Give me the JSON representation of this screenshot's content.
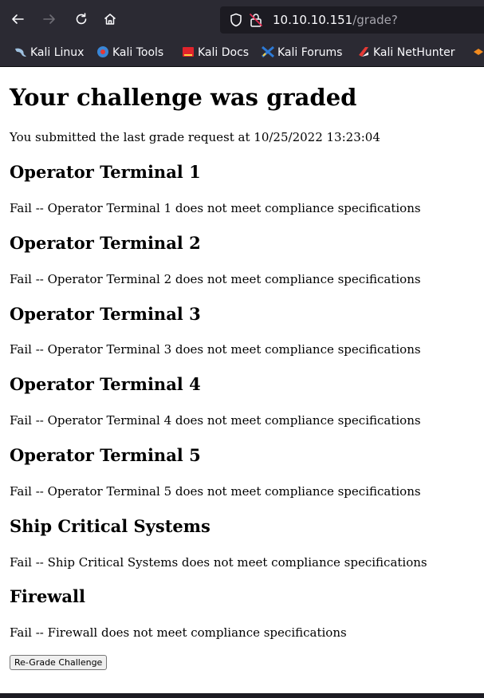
{
  "browser": {
    "url_host": "10.10.10.151",
    "url_path": "/grade?",
    "bookmarks": [
      {
        "label": "Kali Linux",
        "icon": "kali-dragon-icon",
        "color": "#9fc1e0"
      },
      {
        "label": "Kali Tools",
        "icon": "kali-tools-icon",
        "color": "#3a86d6"
      },
      {
        "label": "Kali Docs",
        "icon": "kali-docs-icon",
        "color": "#e0242c"
      },
      {
        "label": "Kali Forums",
        "icon": "kali-forums-icon",
        "color": "#2d7ad6"
      },
      {
        "label": "Kali NetHunter",
        "icon": "kali-nethunter-icon",
        "color": "#e53935"
      }
    ]
  },
  "page": {
    "title": "Your challenge was graded",
    "submitted_text": "You submitted the last grade request at 10/25/2022 13:23:04",
    "sections": [
      {
        "heading": "Operator Terminal 1",
        "result": "Fail -- Operator Terminal 1 does not meet compliance specifications"
      },
      {
        "heading": "Operator Terminal 2",
        "result": "Fail -- Operator Terminal 2 does not meet compliance specifications"
      },
      {
        "heading": "Operator Terminal 3",
        "result": "Fail -- Operator Terminal 3 does not meet compliance specifications"
      },
      {
        "heading": "Operator Terminal 4",
        "result": "Fail -- Operator Terminal 4 does not meet compliance specifications"
      },
      {
        "heading": "Operator Terminal 5",
        "result": "Fail -- Operator Terminal 5 does not meet compliance specifications"
      },
      {
        "heading": "Ship Critical Systems",
        "result": "Fail -- Ship Critical Systems does not meet compliance specifications"
      },
      {
        "heading": "Firewall",
        "result": "Fail -- Firewall does not meet compliance specifications"
      }
    ],
    "regrade_button": "Re-Grade Challenge"
  }
}
